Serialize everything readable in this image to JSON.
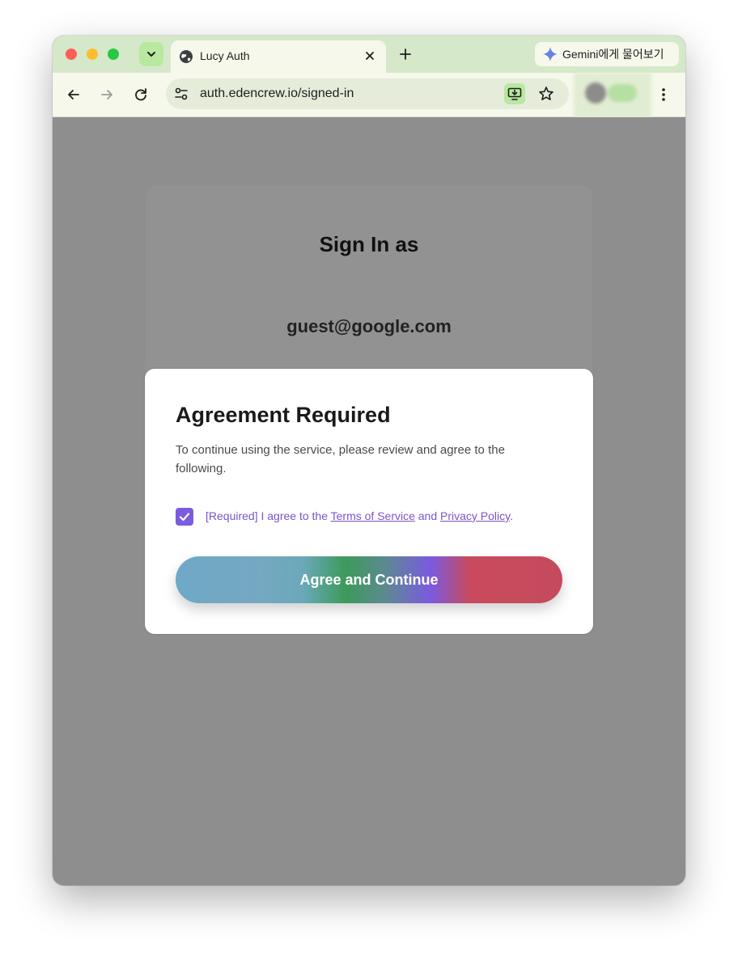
{
  "browser": {
    "tab": {
      "title": "Lucy Auth"
    },
    "gemini_label": "Gemini에게 물어보기",
    "url": "auth.edencrew.io/signed-in"
  },
  "signin": {
    "title": "Sign In as",
    "email": "guest@google.com"
  },
  "modal": {
    "title": "Agreement Required",
    "description": "To continue using the service, please review and agree to the following.",
    "consent": {
      "prefix": "[Required] I agree to the ",
      "terms_link": "Terms of Service",
      "conjunction": " and ",
      "privacy_link": "Privacy Policy",
      "suffix": "."
    },
    "checkbox_checked": true,
    "button_label": "Agree and Continue"
  },
  "colors": {
    "accent": "#7b5ce0",
    "link": "#7a54c8"
  },
  "icons": {
    "tab_search": "chevron-down-icon",
    "tab_favicon": "globe-icon",
    "tab_close": "close-icon",
    "new_tab": "plus-icon",
    "gemini": "sparkle-icon",
    "back": "arrow-left-icon",
    "forward": "arrow-right-icon",
    "reload": "reload-icon",
    "site_info": "tune-icon",
    "install": "install-app-icon",
    "bookmark": "star-icon",
    "menu": "kebab-icon",
    "check": "check-icon"
  }
}
